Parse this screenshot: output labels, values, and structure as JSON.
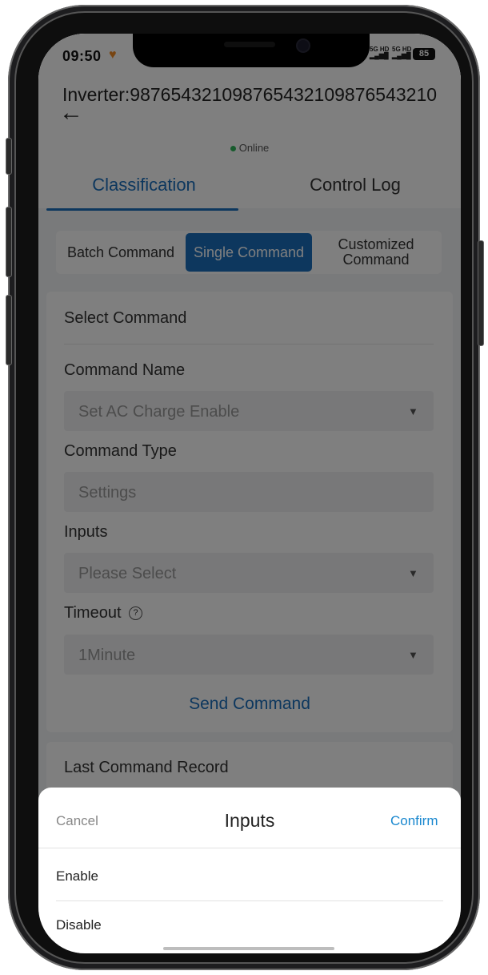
{
  "status_bar": {
    "time": "09:50",
    "signal_left": "5G HD",
    "signal_right": "5G HD",
    "battery": "85"
  },
  "header": {
    "title": "Inverter:987654321098765432109876543210",
    "back_icon": "arrow-left-icon",
    "status": "Online",
    "status_color": "#2fb65b"
  },
  "tabs": [
    {
      "label": "Classification",
      "active": true
    },
    {
      "label": "Control Log",
      "active": false
    }
  ],
  "segments": [
    {
      "label": "Batch Command",
      "active": false
    },
    {
      "label": "Single Command",
      "active": true
    },
    {
      "label": "Customized Command",
      "active": false
    }
  ],
  "form": {
    "section_title": "Select Command",
    "command_name_label": "Command Name",
    "command_name_value": "Set AC Charge Enable",
    "command_type_label": "Command Type",
    "command_type_value": "Settings",
    "inputs_label": "Inputs",
    "inputs_placeholder": "Please Select",
    "timeout_label": "Timeout",
    "timeout_value": "1Minute",
    "send_label": "Send Command"
  },
  "last_record": {
    "title": "Last Command Record"
  },
  "sheet": {
    "cancel": "Cancel",
    "title": "Inputs",
    "confirm": "Confirm",
    "options": [
      "Enable",
      "Disable"
    ]
  },
  "colors": {
    "accent": "#1a6fbd",
    "confirm": "#1a88cf"
  }
}
